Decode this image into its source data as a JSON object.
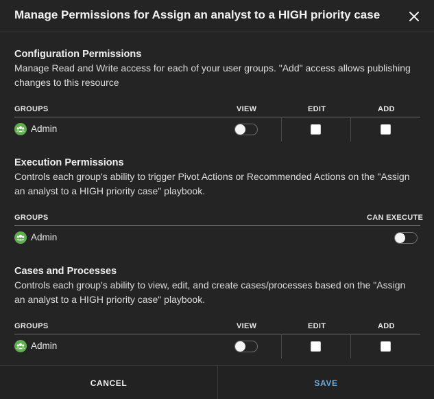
{
  "dialog": {
    "title": "Manage Permissions for Assign an analyst to a HIGH priority case"
  },
  "configuration": {
    "title": "Configuration Permissions",
    "description": "Manage Read and Write access for each of your user groups. \"Add\" access allows publishing changes to this resource",
    "columns": {
      "groups": "GROUPS",
      "view": "VIEW",
      "edit": "EDIT",
      "add": "ADD"
    },
    "rows": [
      {
        "group": "Admin",
        "view": false,
        "edit": false,
        "add": false
      }
    ]
  },
  "execution": {
    "title": "Execution Permissions",
    "description": "Controls each group's ability to trigger Pivot Actions or Recommended Actions on the \"Assign an analyst to a HIGH priority case\" playbook.",
    "columns": {
      "groups": "GROUPS",
      "can_execute": "CAN EXECUTE"
    },
    "rows": [
      {
        "group": "Admin",
        "can_execute": false
      }
    ]
  },
  "cases": {
    "title": "Cases and Processes",
    "description": "Controls each group's ability to view, edit, and create cases/processes based on the \"Assign an analyst to a HIGH priority case\" playbook.",
    "columns": {
      "groups": "GROUPS",
      "view": "VIEW",
      "edit": "EDIT",
      "add": "ADD"
    },
    "rows": [
      {
        "group": "Admin",
        "view": false,
        "edit": false,
        "add": false
      }
    ]
  },
  "footer": {
    "cancel_label": "CANCEL",
    "save_label": "SAVE"
  },
  "icons": {
    "close": "close-icon",
    "group": "group-icon"
  },
  "colors": {
    "background": "#242424",
    "save_accent": "#6fa9d6",
    "group_icon": "#5fae4f"
  }
}
